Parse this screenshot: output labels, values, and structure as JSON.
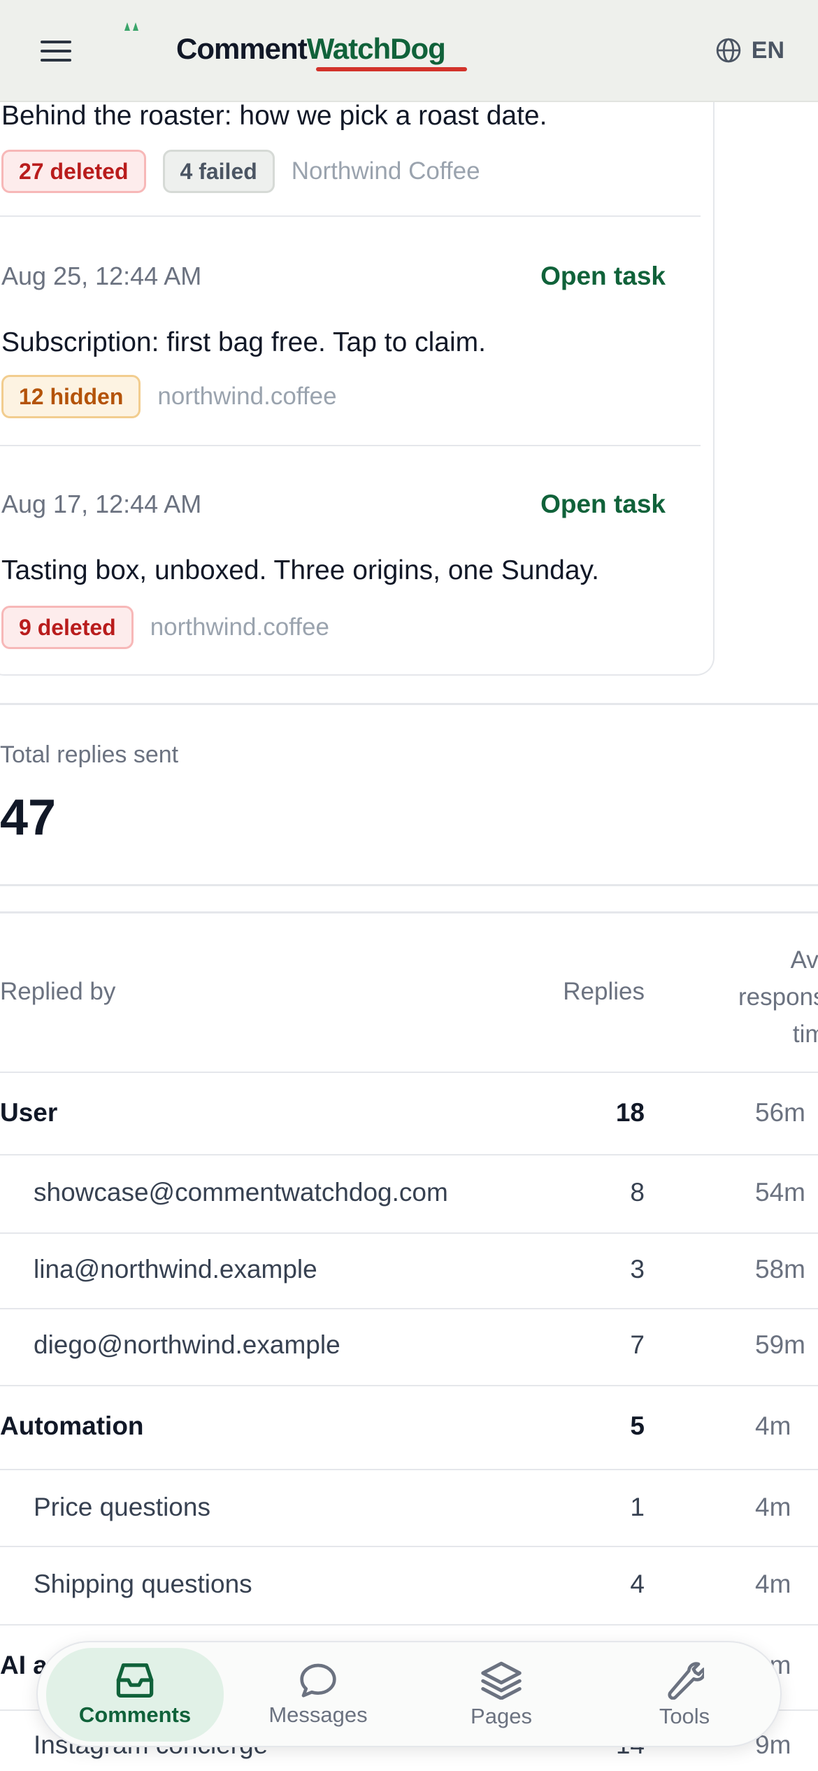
{
  "app": {
    "logo_part1": "Comment",
    "logo_part2": "WatchDog",
    "language": "EN",
    "brand_color": "#10623a",
    "accent_color": "#d2332b"
  },
  "posts": [
    {
      "text": "Behind the roaster: how we pick a roast date.",
      "badges": [
        {
          "label": "27 deleted",
          "kind": "deleted"
        },
        {
          "label": "4 failed",
          "kind": "failed"
        }
      ],
      "source": "Northwind Coffee"
    },
    {
      "date": "Aug 25, 12:44 AM",
      "action": "Open task",
      "text": "Subscription: first bag free. Tap to claim.",
      "badges": [
        {
          "label": "12 hidden",
          "kind": "hidden"
        }
      ],
      "source": "northwind.coffee"
    },
    {
      "date": "Aug 17, 12:44 AM",
      "action": "Open task",
      "text": "Tasting box, unboxed. Three origins, one Sunday.",
      "badges": [
        {
          "label": "9 deleted",
          "kind": "deleted"
        }
      ],
      "source": "northwind.coffee"
    }
  ],
  "totals": {
    "label": "Total replies sent",
    "value": "47"
  },
  "table": {
    "headers": {
      "replied_by": "Replied by",
      "replies": "Replies",
      "avg_line1": "Avg.",
      "avg_line2": "response",
      "avg_line3": "time"
    },
    "rows": [
      {
        "name": "User",
        "replies": "18",
        "avg": "56m",
        "type": "group"
      },
      {
        "name": "showcase@commentwatchdog.com",
        "replies": "8",
        "avg": "54m",
        "type": "sub"
      },
      {
        "name": "lina@northwind.example",
        "replies": "3",
        "avg": "58m",
        "type": "sub"
      },
      {
        "name": "diego@northwind.example",
        "replies": "7",
        "avg": "59m",
        "type": "sub"
      },
      {
        "name": "Automation",
        "replies": "5",
        "avg": "4m",
        "type": "group"
      },
      {
        "name": "Price questions",
        "replies": "1",
        "avg": "4m",
        "type": "sub"
      },
      {
        "name": "Shipping questions",
        "replies": "4",
        "avg": "4m",
        "type": "sub"
      },
      {
        "name": "AI a",
        "replies": "",
        "avg": "9m",
        "type": "group"
      },
      {
        "name": "Instagram concierge",
        "replies": "14",
        "avg": "9m",
        "type": "sub"
      }
    ]
  },
  "nav": {
    "items": [
      {
        "label": "Comments",
        "icon": "inbox-icon",
        "active": true
      },
      {
        "label": "Messages",
        "icon": "chat-bubble-icon",
        "active": false
      },
      {
        "label": "Pages",
        "icon": "layers-icon",
        "active": false
      },
      {
        "label": "Tools",
        "icon": "wrench-icon",
        "active": false
      }
    ]
  }
}
